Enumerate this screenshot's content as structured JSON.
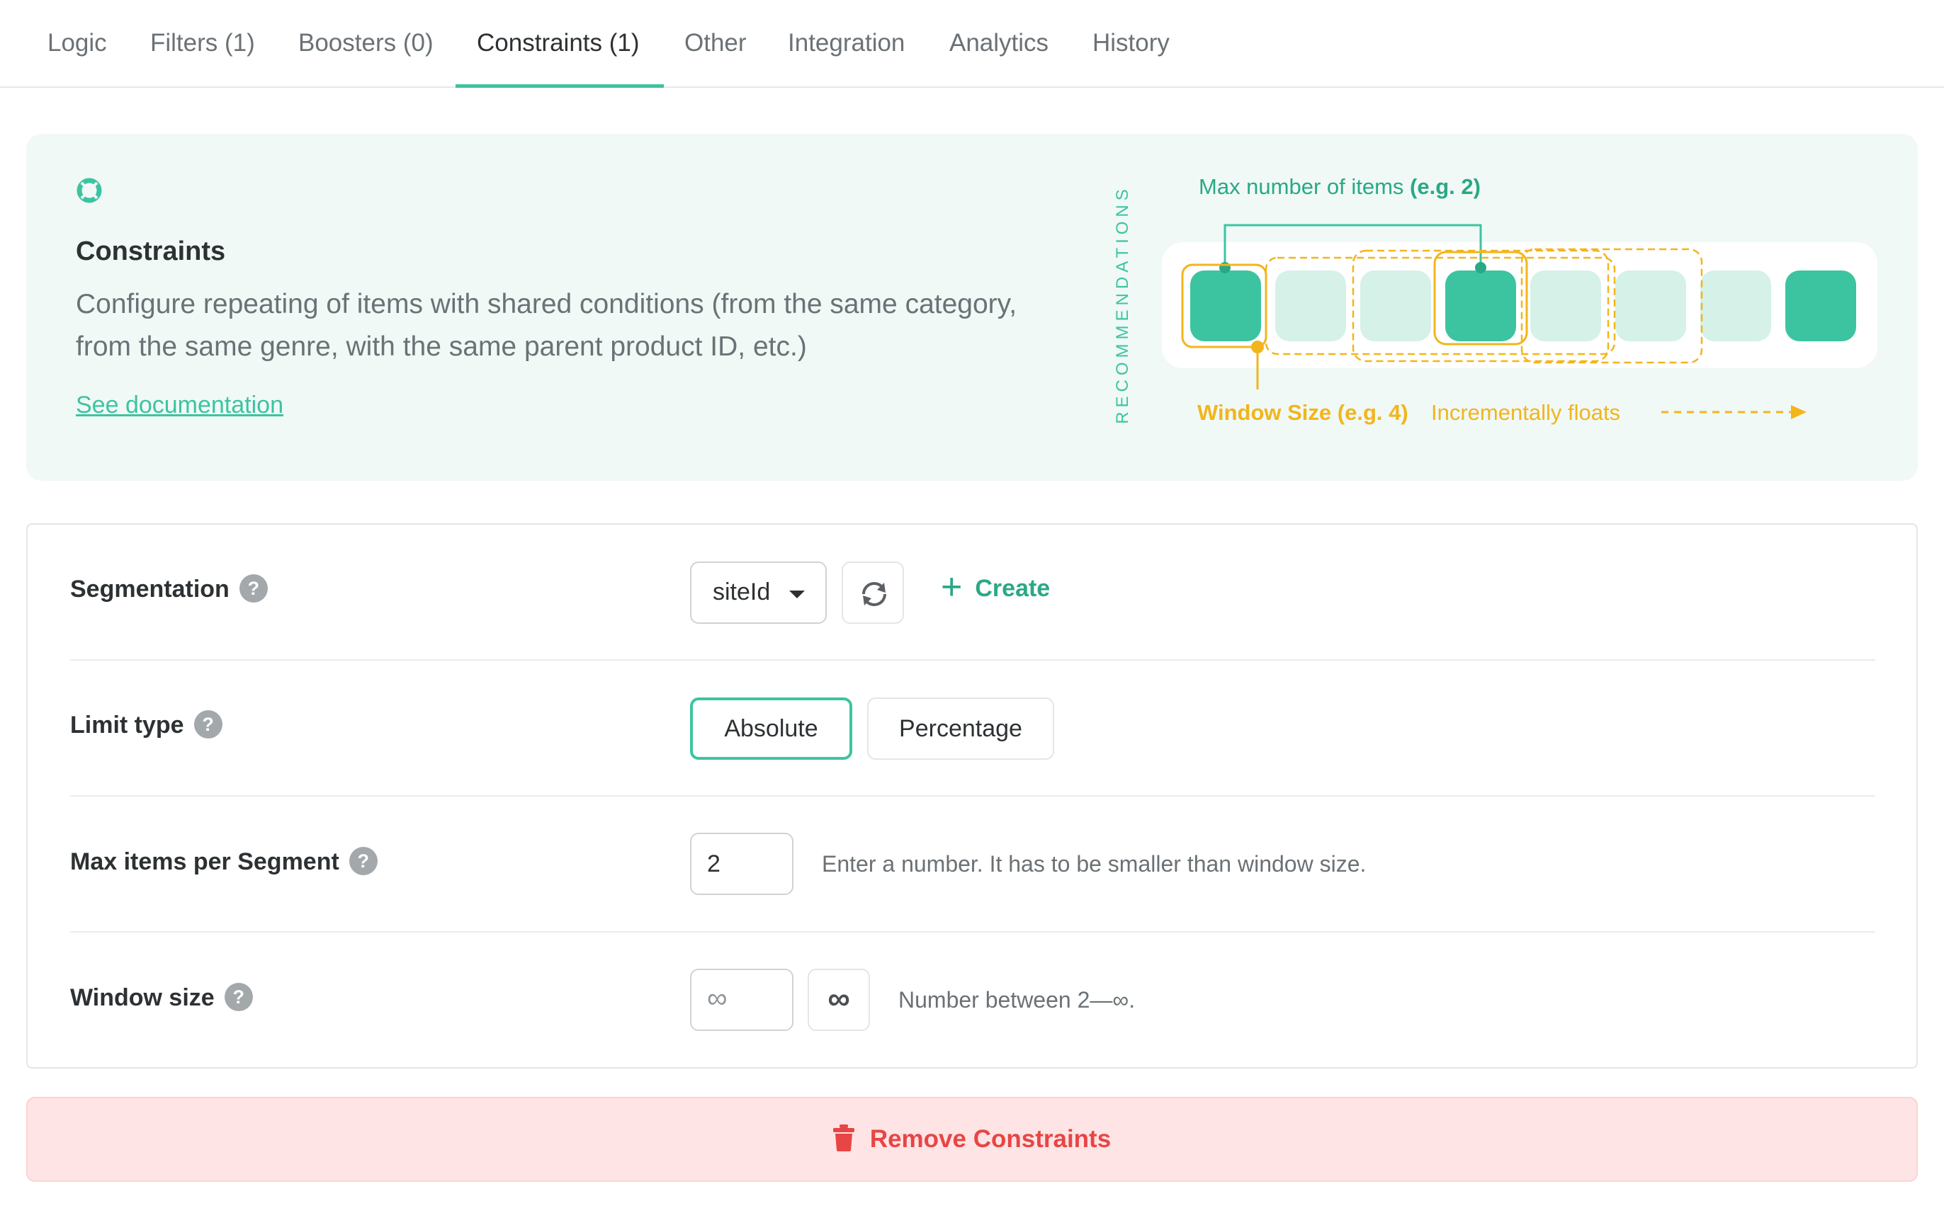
{
  "tabs": [
    {
      "label": "Logic"
    },
    {
      "label": "Filters (1)"
    },
    {
      "label": "Boosters (0)"
    },
    {
      "label": "Constraints (1)",
      "active": true
    },
    {
      "label": "Other"
    },
    {
      "label": "Integration"
    },
    {
      "label": "Analytics"
    },
    {
      "label": "History"
    }
  ],
  "info": {
    "icon": "lifebuoy-icon",
    "title": "Constraints",
    "description": "Configure repeating of items with shared conditions (from the same category, from the same genre, with the same parent product ID, etc.)",
    "link": "See documentation",
    "diagram": {
      "side_label": "RECOMMENDATIONS",
      "max_items_text": "Max number of items ",
      "max_items_example": "(e.g. 2)",
      "window_size_label": "Window Size (e.g. 4)",
      "floats_label": "Incrementally floats",
      "items": [
        true,
        false,
        false,
        true,
        false,
        false,
        false,
        true
      ]
    }
  },
  "form": {
    "segmentation": {
      "label": "Segmentation",
      "value": "siteId",
      "create_label": "Create"
    },
    "limit_type": {
      "label": "Limit type",
      "options": [
        "Absolute",
        "Percentage"
      ],
      "selected": "Absolute"
    },
    "max_items": {
      "label": "Max items per Segment",
      "value": "2",
      "hint": "Enter a number. It has to be smaller than window size."
    },
    "window_size": {
      "label": "Window size",
      "placeholder": "∞",
      "infinity_label": "∞",
      "hint": "Number between 2—∞."
    }
  },
  "remove_label": "Remove Constraints",
  "colors": {
    "accent": "#3cc4a0",
    "accent_light": "#d5f1e8",
    "warning": "#f2b51c",
    "danger": "#e84545",
    "danger_bg": "#fee4e4"
  }
}
